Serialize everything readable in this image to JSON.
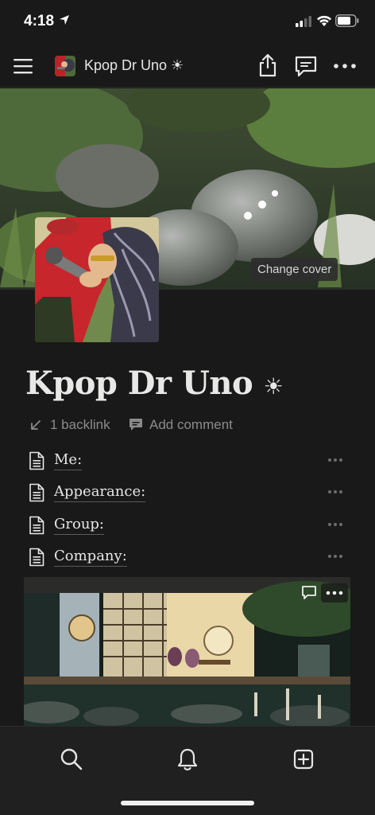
{
  "status_bar": {
    "time": "4:18"
  },
  "nav": {
    "title": "Kpop Dr Uno ☀︎",
    "icons": {
      "menu": "hamburger-menu-icon",
      "share": "share-icon",
      "comments": "comments-icon",
      "more": "more-horizontal-icon"
    }
  },
  "cover": {
    "change_cover_label": "Change cover"
  },
  "page": {
    "title_text": "Kpop Dr Uno",
    "title_emoji": "☀︎",
    "backlink_label": "1 backlink",
    "add_comment_label": "Add comment"
  },
  "properties": [
    {
      "label": "Me:"
    },
    {
      "label": "Appearance:"
    },
    {
      "label": "Group:"
    },
    {
      "label": "Company:"
    }
  ],
  "bottom_bar": {
    "tabs": [
      "search-icon",
      "bell-icon",
      "new-page-icon"
    ]
  },
  "colors": {
    "background": "#191919",
    "text": "#e9e9e7",
    "muted": "#8b8b8b"
  }
}
